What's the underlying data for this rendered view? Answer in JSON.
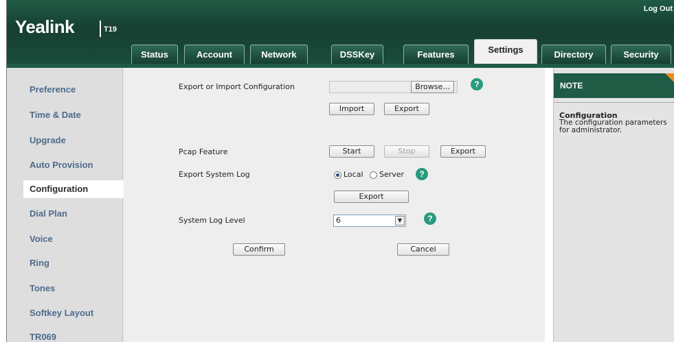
{
  "header": {
    "logo": "Yealink",
    "model": "T19",
    "logout": "Log Out"
  },
  "tabs": [
    {
      "label": "Status"
    },
    {
      "label": "Account"
    },
    {
      "label": "Network"
    },
    {
      "label": "DSSKey"
    },
    {
      "label": "Features"
    },
    {
      "label": "Settings",
      "active": true
    },
    {
      "label": "Directory"
    },
    {
      "label": "Security"
    }
  ],
  "sidebar": {
    "items": [
      {
        "label": "Preference"
      },
      {
        "label": "Time & Date"
      },
      {
        "label": "Upgrade"
      },
      {
        "label": "Auto Provision"
      },
      {
        "label": "Configuration",
        "active": true
      },
      {
        "label": "Dial Plan"
      },
      {
        "label": "Voice"
      },
      {
        "label": "Ring"
      },
      {
        "label": "Tones"
      },
      {
        "label": "Softkey Layout"
      },
      {
        "label": "TR069"
      }
    ]
  },
  "main": {
    "export_import_label": "Export or Import Configuration",
    "browse_label": "Browse...",
    "import_label": "Import",
    "export_label": "Export",
    "pcap_label": "Pcap Feature",
    "start_label": "Start",
    "stop_label": "Stop",
    "pcap_export_label": "Export",
    "syslog_export_label": "Export System Log",
    "radio_local": "Local",
    "radio_server": "Server",
    "syslog_export_button": "Export",
    "log_level_label": "System Log Level",
    "log_level_value": "6",
    "confirm_label": "Confirm",
    "cancel_label": "Cancel",
    "help_glyph": "?"
  },
  "note": {
    "heading": "NOTE",
    "title": "Configuration",
    "text": "The configuration parameters for administrator."
  },
  "colors": {
    "header": "#1f5b45",
    "sidebar_link": "#4d6b8c",
    "help": "#2a9a7e",
    "note_corner": "#f08a1c"
  }
}
